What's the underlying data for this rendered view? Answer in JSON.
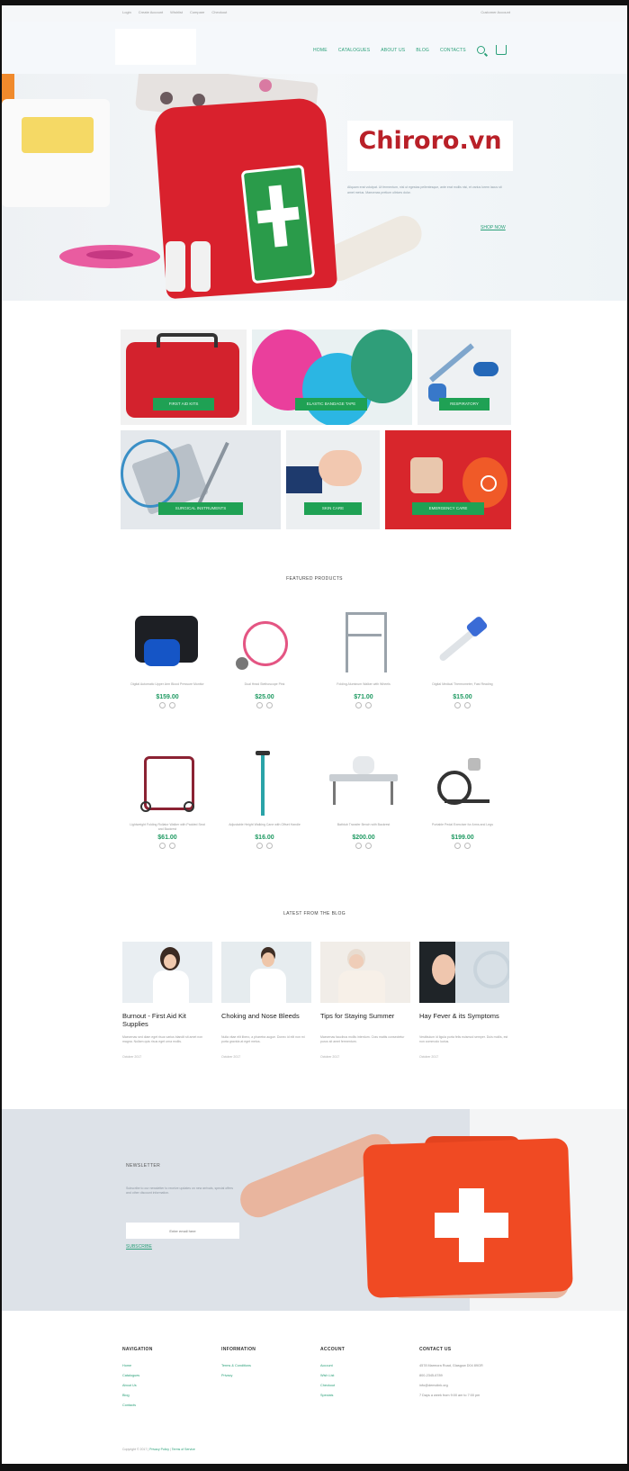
{
  "topbar": {
    "links": [
      "Login",
      "Create Account",
      "Wishlist",
      "Compare",
      "Checkout"
    ],
    "account": "Customer Account"
  },
  "nav": {
    "items": [
      "HOME",
      "CATALOGUES",
      "ABOUT US",
      "BLOG",
      "CONTACTS"
    ]
  },
  "hero": {
    "brand": "Chiroro.vn",
    "description": "Aliquam erat volutpat. Ut fermentum, nisl ut egestas pellentesque, ante erat mollis nisi, et varius lorem lacus sit amet metus. Maecenas pretium ultrices dolor.",
    "cta": "SHOP NOW"
  },
  "categories": [
    {
      "label": "FIRST AID KITS"
    },
    {
      "label": "ELASTIC BANDAGE TAPE"
    },
    {
      "label": "RESPIRATORY"
    },
    {
      "label": "SURGICAL INSTRUMENTS"
    },
    {
      "label": "SKIN CARE"
    },
    {
      "label": "EMERGENCY CARE"
    }
  ],
  "featured": {
    "title": "FEATURED PRODUCTS",
    "products": [
      {
        "name": "Digital Automatic Upper Arm Blood Pressure Monitor",
        "price": "$159.00"
      },
      {
        "name": "Dual Head Stethoscope Pink",
        "price": "$25.00"
      },
      {
        "name": "Folding Aluminum Walker with Wheels",
        "price": "$71.00"
      },
      {
        "name": "Digital Medical Thermometer, Fast Reading",
        "price": "$15.00"
      },
      {
        "name": "Lightweight Folding Rollator Walker with Padded Seat and Backrest",
        "price": "$61.00"
      },
      {
        "name": "Adjustable Height Walking Cane with Offset Handle",
        "price": "$16.00"
      },
      {
        "name": "Bathtub Transfer Bench with Backrest",
        "price": "$200.00"
      },
      {
        "name": "Portable Pedal Exerciser for Arms and Legs",
        "price": "$199.00"
      }
    ]
  },
  "blog": {
    "title": "LATEST FROM THE BLOG",
    "posts": [
      {
        "title": "Burnout - First Aid Kit Supplies",
        "excerpt": "Maecenas sed diam eget risus varius blandit sit amet non magna. Nullam quis risus eget urna mollis.",
        "date": "October 2017"
      },
      {
        "title": "Choking and Nose Bleeds",
        "excerpt": "Nulla vitae elit libero, a pharetra augue. Donec id elit non mi porta gravida at eget metus.",
        "date": "October 2017"
      },
      {
        "title": "Tips for Staying Summer",
        "excerpt": "Maecenas faucibus mollis interdum. Cras mattis consectetur purus sit amet fermentum.",
        "date": "October 2017"
      },
      {
        "title": "Hay Fever & its Symptoms",
        "excerpt": "Vestibulum id ligula porta felis euismod semper. Duis mollis, est non commodo luctus.",
        "date": "October 2017"
      }
    ]
  },
  "newsletter": {
    "heading": "NEWSLETTER",
    "text": "Subscribe to our newsletter to receive updates on new arrivals, special offers and other discount information.",
    "placeholder": "Enter email here",
    "button": "SUBSCRIBE"
  },
  "footer": {
    "columns": [
      {
        "heading": "NAVIGATION",
        "links": [
          "Home",
          "Catalogues",
          "About Us",
          "Blog",
          "Contacts"
        ]
      },
      {
        "heading": "INFORMATION",
        "links": [
          "Terms & Conditions",
          "Privacy"
        ]
      },
      {
        "heading": "ACCOUNT",
        "links": [
          "Account",
          "Wish List",
          "Checkout",
          "Specials"
        ]
      },
      {
        "heading": "CONTACT US",
        "text": [
          "4578 Marmora Road, Glasgow D04 89GR",
          "800-2345-6789",
          "info@demolink.org",
          "7 Days a week from 9:00 am to 7:00 pm"
        ]
      }
    ],
    "copyright": "Copyright © 2017",
    "copyright_link1": "Privacy Policy",
    "copyright_link2": "Terms of Service"
  },
  "colors": {
    "accent": "#2aa079",
    "button": "#1fa154",
    "brand": "#b92028"
  }
}
